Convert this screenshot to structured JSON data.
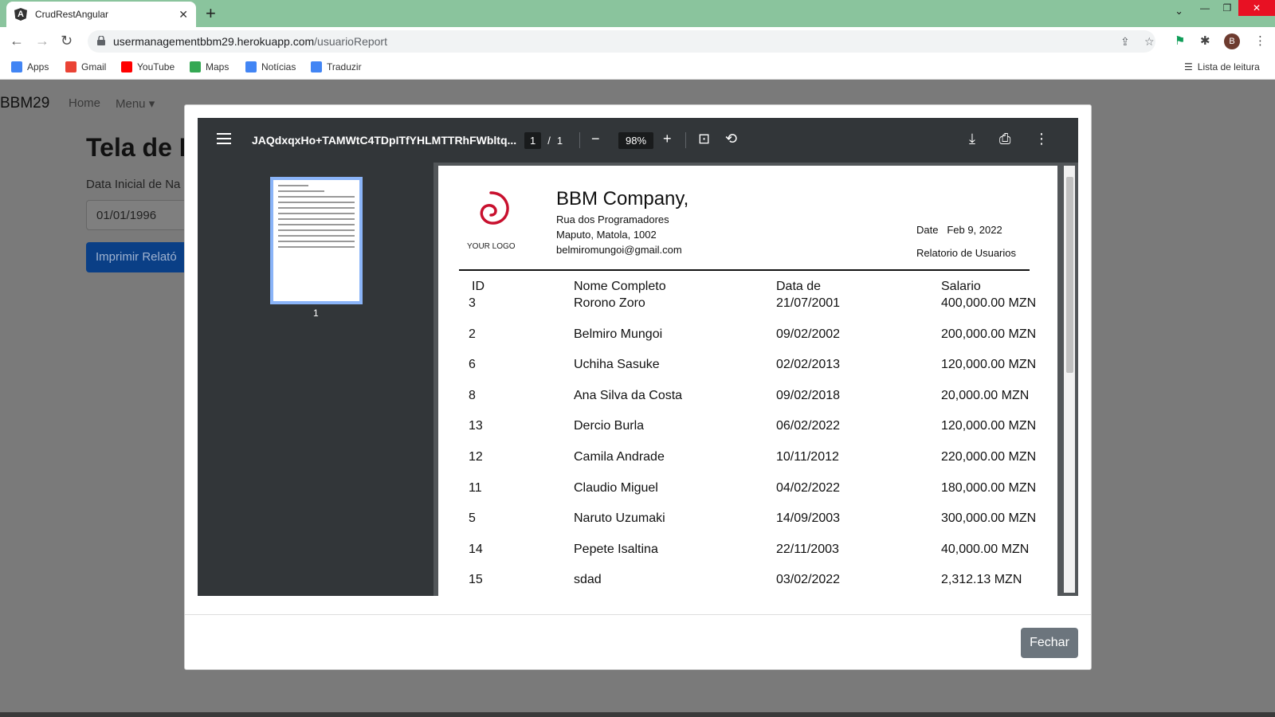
{
  "browser": {
    "tab_title": "CrudRestAngular",
    "url_host": "usermanagementbbm29.herokuapp.com",
    "url_path": "/usuarioReport",
    "avatar_letter": "B",
    "bookmarks": [
      {
        "label": "Apps",
        "icon": "apps-grid-icon",
        "color": "#4285f4"
      },
      {
        "label": "Gmail",
        "icon": "gmail-icon",
        "color": "#ea4335"
      },
      {
        "label": "YouTube",
        "icon": "youtube-icon",
        "color": "#ff0000"
      },
      {
        "label": "Maps",
        "icon": "maps-icon",
        "color": "#34a853"
      },
      {
        "label": "Notícias",
        "icon": "news-icon",
        "color": "#4285f4"
      },
      {
        "label": "Traduzir",
        "icon": "translate-icon",
        "color": "#4285f4"
      }
    ],
    "reading_list": "Lista de leitura"
  },
  "app": {
    "brand": "BBM29",
    "nav_home": "Home",
    "nav_menu": "Menu",
    "page_title": "Tela de R",
    "field_label": "Data Inicial de Na",
    "field_value": "01/01/1996",
    "print_button": "Imprimir Relató"
  },
  "modal": {
    "close_button": "Fechar"
  },
  "pdf_viewer": {
    "file_title": "JAQdxqxHo+TAMWtC4TDpITfYHLMTTRhFWbltq...",
    "current_page": "1",
    "page_separator": "/",
    "total_pages": "1",
    "zoom": "98%",
    "thumbnail_label": "1",
    "accent": "#8ab4f8"
  },
  "report": {
    "company": "BBM Company,",
    "address": [
      "Rua dos Programadores",
      "Maputo, Matola, 1002",
      "belmiromungoi@gmail.com"
    ],
    "logo_text": "YOUR LOGO",
    "date_label": "Date",
    "date_value": "Feb 9, 2022",
    "report_title": "Relatorio de Usuarios",
    "columns": [
      "ID",
      "Nome Completo",
      "Data de",
      "Salario"
    ],
    "rows": [
      [
        "3",
        "Rorono Zoro",
        "21/07/2001",
        "400,000.00 MZN"
      ],
      [
        "2",
        "Belmiro Mungoi",
        "09/02/2002",
        "200,000.00 MZN"
      ],
      [
        "6",
        "Uchiha Sasuke",
        "02/02/2013",
        "120,000.00 MZN"
      ],
      [
        "8",
        "Ana Silva da Costa",
        "09/02/2018",
        "20,000.00 MZN"
      ],
      [
        "13",
        "Dercio Burla",
        "06/02/2022",
        "120,000.00 MZN"
      ],
      [
        "12",
        "Camila Andrade",
        "10/11/2012",
        "220,000.00 MZN"
      ],
      [
        "11",
        "Claudio Miguel",
        "04/02/2022",
        "180,000.00 MZN"
      ],
      [
        "5",
        "Naruto Uzumaki",
        "14/09/2003",
        "300,000.00 MZN"
      ],
      [
        "14",
        "Pepete Isaltina",
        "22/11/2003",
        "40,000.00 MZN"
      ],
      [
        "15",
        "sdad",
        "03/02/2022",
        "2,312.13 MZN"
      ]
    ]
  }
}
